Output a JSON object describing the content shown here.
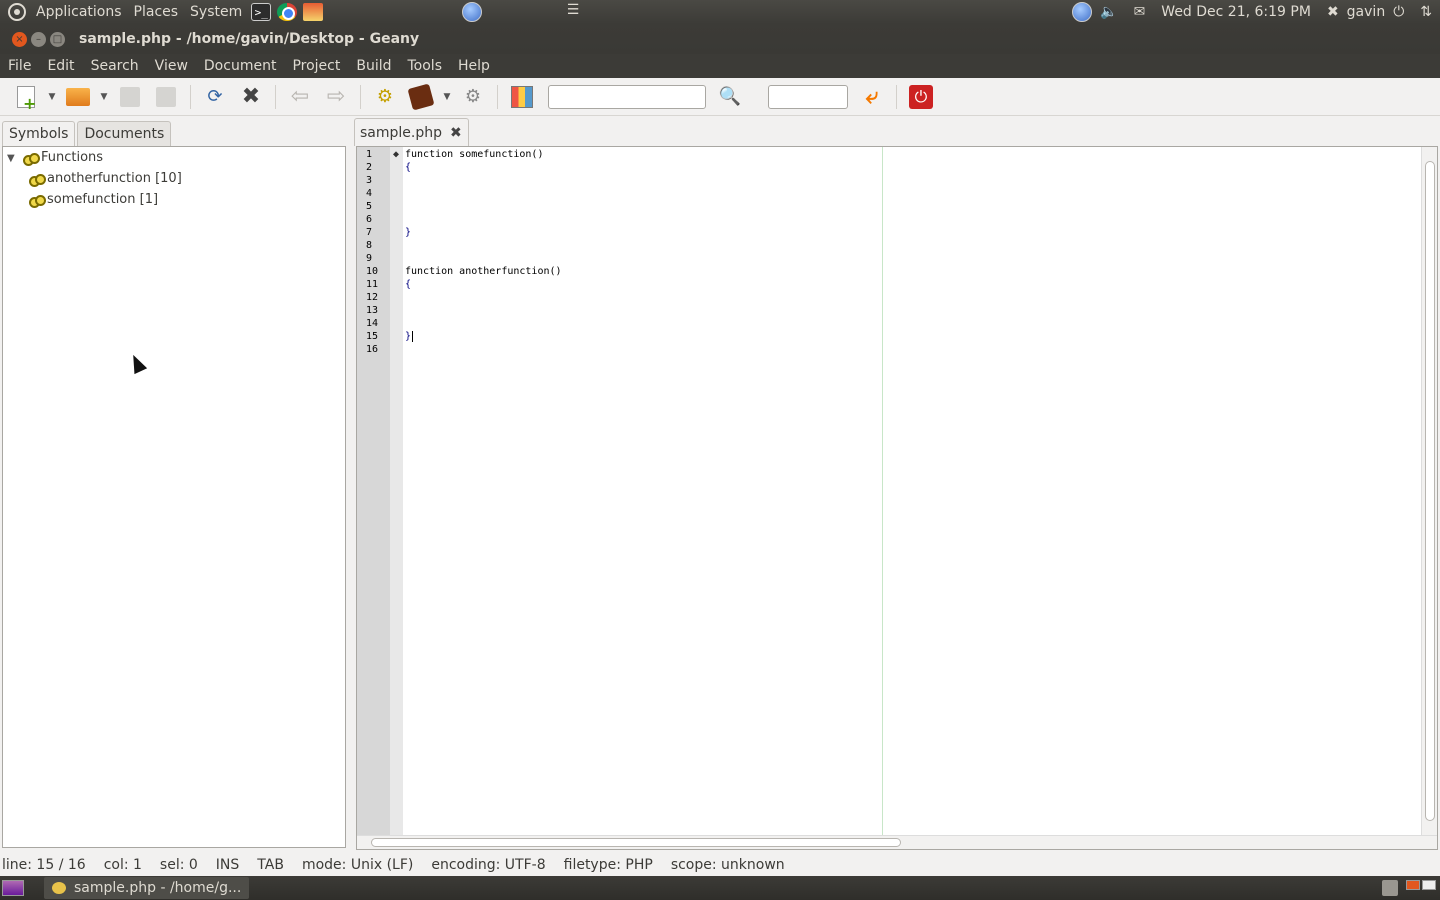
{
  "top_panel": {
    "menus": [
      "Applications",
      "Places",
      "System"
    ],
    "clock": "Wed Dec 21,  6:19 PM",
    "user": "gavin"
  },
  "window": {
    "title": "sample.php - /home/gavin/Desktop - Geany"
  },
  "menu_bar": {
    "items": [
      "File",
      "Edit",
      "Search",
      "View",
      "Document",
      "Project",
      "Build",
      "Tools",
      "Help"
    ]
  },
  "toolbar": {
    "search_value": "",
    "goto_value": ""
  },
  "sidebar": {
    "tabs": [
      "Symbols",
      "Documents"
    ],
    "active_tab": "Symbols",
    "tree": {
      "root": "Functions",
      "items": [
        "anotherfunction [10]",
        "somefunction [1]"
      ]
    }
  },
  "editor": {
    "tab_label": "sample.php",
    "lines": [
      {
        "n": "1",
        "text": "function somefunction()"
      },
      {
        "n": "2",
        "text": "{"
      },
      {
        "n": "3",
        "text": ""
      },
      {
        "n": "4",
        "text": ""
      },
      {
        "n": "5",
        "text": ""
      },
      {
        "n": "6",
        "text": ""
      },
      {
        "n": "7",
        "text": "}"
      },
      {
        "n": "8",
        "text": ""
      },
      {
        "n": "9",
        "text": ""
      },
      {
        "n": "10",
        "text": "function anotherfunction()"
      },
      {
        "n": "11",
        "text": "{"
      },
      {
        "n": "12",
        "text": ""
      },
      {
        "n": "13",
        "text": ""
      },
      {
        "n": "14",
        "text": ""
      },
      {
        "n": "15",
        "text": "}"
      },
      {
        "n": "16",
        "text": ""
      }
    ]
  },
  "status_bar": {
    "line": "line: 15 / 16",
    "col": "col: 1",
    "sel": "sel: 0",
    "ins": "INS",
    "tab": "TAB",
    "mode": "mode: Unix (LF)",
    "encoding": "encoding: UTF-8",
    "filetype": "filetype: PHP",
    "scope": "scope: unknown"
  },
  "taskbar": {
    "task_label": "sample.php - /home/g..."
  },
  "icons": {
    "app_menu": "ubuntu-logo-icon",
    "terminal": "terminal-icon",
    "chrome": "chrome-icon",
    "mail": "mail-icon",
    "volume": "volume-icon",
    "power": "power-icon"
  }
}
